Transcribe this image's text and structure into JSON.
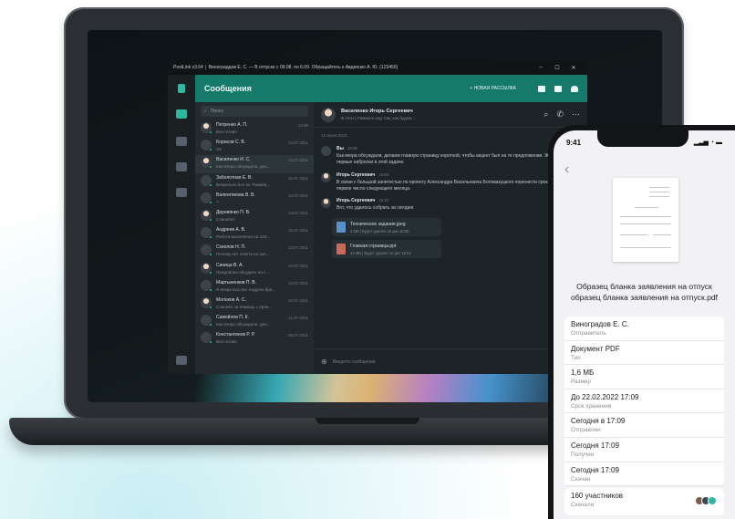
{
  "app": {
    "window_title": "PostLink v3.64  │  Винограддов Е. С. — В отпуске с 09.08. по 6.09. Обращайтесь к Авдеенко А. Ю. (123456)",
    "header_title": "Сообщения",
    "new_broadcast_label": "+ НОВАЯ РАССЫЛКА",
    "search_placeholder": "Поиск",
    "chats": [
      {
        "name": "Петренко А. П.",
        "preview": "Все готово",
        "time": "13:06",
        "photo": true
      },
      {
        "name": "Борисов С. В.",
        "preview": "Ок",
        "time": "13.07.2021",
        "photo": false
      },
      {
        "name": "Василенко И. С.",
        "preview": "Как вчера обсуждали, дел...",
        "time": "13.07.2021",
        "photo": true
      },
      {
        "name": "Заболотная Е. В.",
        "preview": "Визуально все ок. Размер...",
        "time": "16.07.2021",
        "photo": false
      },
      {
        "name": "Валентинова В. В.",
        "preview": "?",
        "time": "13.07.2021",
        "photo": false
      },
      {
        "name": "Деревянко П. В.",
        "preview": "Спасибо!",
        "time": "13.07.2021",
        "photo": true
      },
      {
        "name": "Андреев А. В.",
        "preview": "Работа выполнена на 120...",
        "time": "16.07.2021",
        "photo": false
      },
      {
        "name": "Соколов Н. П.",
        "preview": "Почему нет ответа на зап...",
        "time": "13.07.2021",
        "photo": false
      },
      {
        "name": "Синица В. А.",
        "preview": "Предлагаю обсудить на с...",
        "time": "14.07.2021",
        "photo": true
      },
      {
        "name": "Мартыненков П. В.",
        "preview": "Я вчера выслал Андрею бри...",
        "time": "13.07.2021",
        "photo": false
      },
      {
        "name": "Молоков А. С.",
        "preview": "Спасибо за помощь с прое...",
        "time": "12.07.2021",
        "photo": true
      },
      {
        "name": "Самойлов П. К.",
        "preview": "Как вчера обсуждали, дел...",
        "time": "11.07.2021",
        "photo": false
      },
      {
        "name": "Константинов Р. Р.",
        "preview": "Все готово",
        "time": "09.07.2021",
        "photo": false
      }
    ],
    "conversation": {
      "name": "Василенко Игорь Сергеевич",
      "status": "В сети  |  Помните ход том, как будем...",
      "date_divider": "13 июля 2021",
      "messages": [
        {
          "author": "Вы",
          "time": "15:06",
          "text": "Как вчера обсуждали, делаем главную страницу короткой, чтобы акцент был на те предложении. Ждем от тебя первые наброски в этой задаче."
        },
        {
          "author": "Игорь Сергеевич",
          "time": "16:00",
          "text": "В связи с большой занятостью по проекту Александра Васильевича Богомазуцкого перенести сроки по задаче на первое число следующего месяца."
        },
        {
          "author": "Игорь Сергеевич",
          "time": "18:22",
          "text": "Вот, что удалось собрать за сегодня"
        }
      ],
      "files": [
        {
          "name": "Техническое задание.jpeg",
          "meta": "2 МБ  |  Будет удален 15 дек 15:00"
        },
        {
          "name": "Главная страница.ppt",
          "meta": "13 МБ  |  Будет удален 15 дек 15:02"
        }
      ],
      "composer_placeholder": "Введите сообщение"
    }
  },
  "phone": {
    "time": "9:41",
    "file_title_line1": "Образец бланка заявления на отпуск",
    "file_title_line2": "образец бланка заявления на отпуск.pdf",
    "details": [
      {
        "value": "Виноградов Е. С.",
        "label": "Отправитель"
      },
      {
        "value": "Документ PDF",
        "label": "Тип"
      },
      {
        "value": "1,6 МБ",
        "label": "Размер"
      },
      {
        "value": "До 22.02.2022 17:09",
        "label": "Срок хранения"
      },
      {
        "value": "Сегодня в 17:09",
        "label": "Отправлен"
      },
      {
        "value": "Сегодня 17:09",
        "label": "Получен"
      },
      {
        "value": "Сегодня 17:09",
        "label": "Скачан"
      }
    ],
    "participants_value": "160 участников",
    "participants_label": "Скачали"
  },
  "colors": {
    "accent": "#167a6b",
    "online": "#2fd07a",
    "app_bg": "#1f2529"
  }
}
